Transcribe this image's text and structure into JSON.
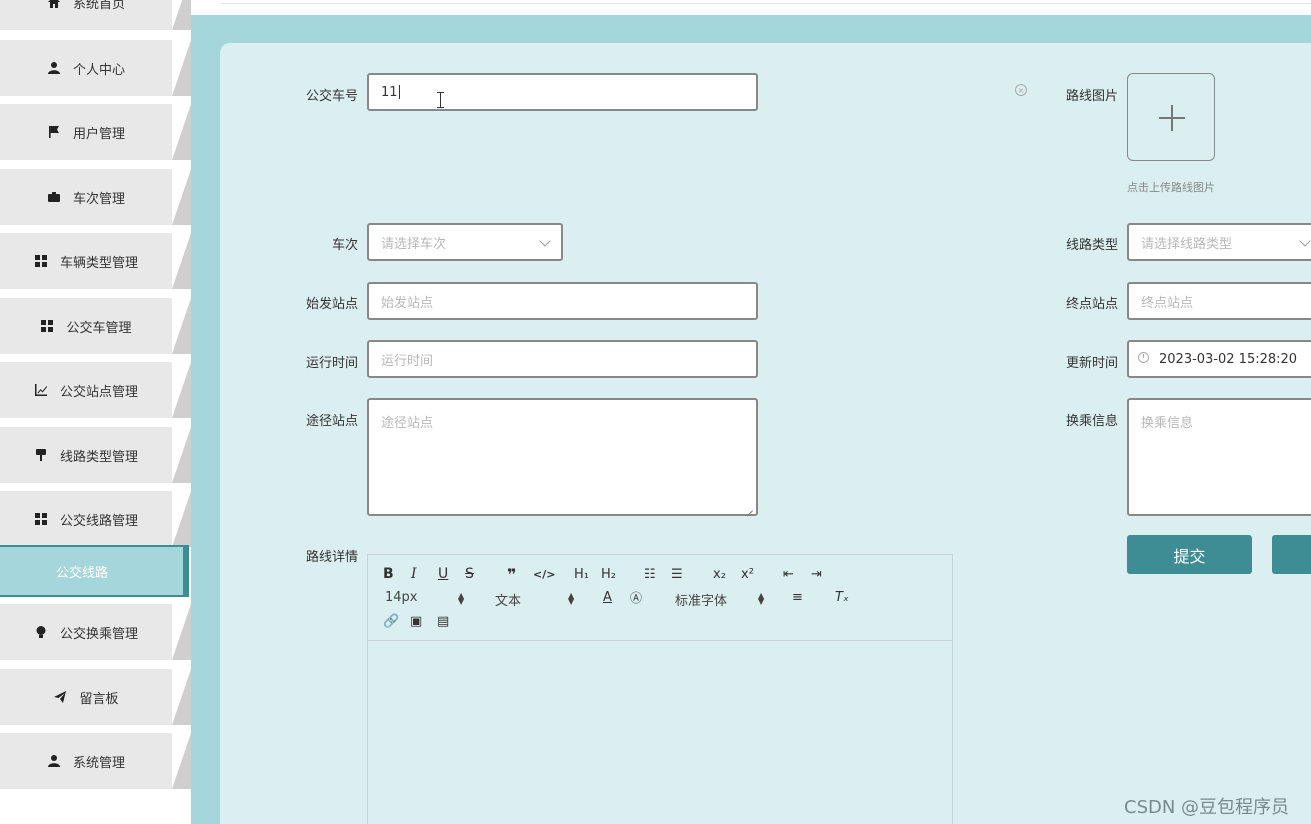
{
  "sidebar": {
    "items": [
      {
        "label": "系统首页",
        "icon": "home-icon"
      },
      {
        "label": "个人中心",
        "icon": "user-icon"
      },
      {
        "label": "用户管理",
        "icon": "flag-icon"
      },
      {
        "label": "车次管理",
        "icon": "briefcase-icon"
      },
      {
        "label": "车辆类型管理",
        "icon": "grid-icon"
      },
      {
        "label": "公交车管理",
        "icon": "grid-icon"
      },
      {
        "label": "公交站点管理",
        "icon": "line-chart-icon"
      },
      {
        "label": "线路类型管理",
        "icon": "brush-icon"
      },
      {
        "label": "公交线路管理",
        "icon": "grid-icon"
      },
      {
        "label": "公交换乘管理",
        "icon": "lightbulb-icon"
      },
      {
        "label": "留言板",
        "icon": "paper-plane-icon"
      },
      {
        "label": "系统管理",
        "icon": "user-admin-icon"
      }
    ],
    "active_sub": "公交线路"
  },
  "form": {
    "bus_no": {
      "label": "公交车号",
      "value": "11"
    },
    "route_image": {
      "label": "路线图片",
      "tip": "点击上传路线图片"
    },
    "trip": {
      "label": "车次",
      "placeholder": "请选择车次"
    },
    "route_type": {
      "label": "线路类型",
      "placeholder": "请选择线路类型"
    },
    "start_station": {
      "label": "始发站点",
      "placeholder": "始发站点"
    },
    "end_station": {
      "label": "终点站点",
      "placeholder": "终点站点"
    },
    "run_time": {
      "label": "运行时间",
      "placeholder": "运行时间"
    },
    "update_time": {
      "label": "更新时间",
      "value": "2023-03-02 15:28:20"
    },
    "via_stations": {
      "label": "途径站点",
      "placeholder": "途径站点"
    },
    "transfer_info": {
      "label": "换乘信息",
      "placeholder": "换乘信息"
    },
    "route_detail": {
      "label": "路线详情"
    },
    "submit_label": "提交"
  },
  "editor": {
    "font_size": "14px",
    "block_format": "文本",
    "font_family": "标准字体"
  },
  "watermark": "CSDN @豆包程序员",
  "colors": {
    "accent": "#3f8d94",
    "panel": "#dbeef0",
    "frame": "#a4d6dc"
  }
}
